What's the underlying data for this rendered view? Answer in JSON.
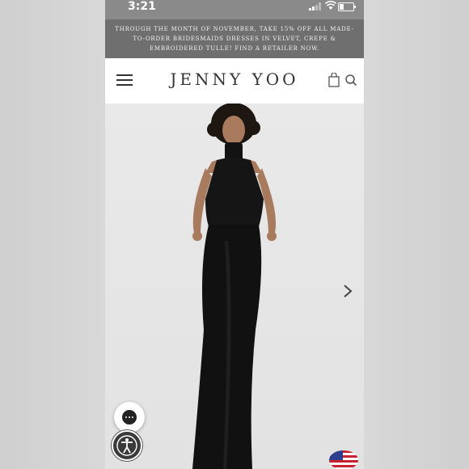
{
  "status": {
    "time": "3:21"
  },
  "promo": {
    "text": "THROUGH THE MONTH OF NOVEMBER, TAKE 15% OFF ALL MADE-TO-ORDER BRIDESMAIDS DRESSES IN VELVET, CREPE & EMBROIDERED TULLE! FIND A RETAILER NOW."
  },
  "header": {
    "brand": "JENNY YOO"
  },
  "icons": {
    "menu": "hamburger-menu-icon",
    "bag": "shopping-bag-icon",
    "search": "search-icon",
    "next": "chevron-right-icon",
    "chat": "chat-bubble-icon",
    "accessibility": "accessibility-icon",
    "flag": "us-flag-icon"
  },
  "colors": {
    "promo_bg": "#6f6f6f",
    "header_bg": "#ffffff",
    "dress": "#111111"
  }
}
